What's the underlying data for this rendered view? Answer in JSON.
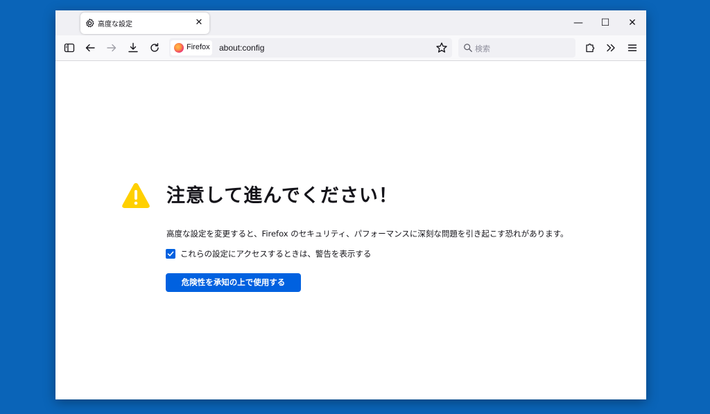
{
  "tab": {
    "title": "高度な設定",
    "icon": "gear-icon"
  },
  "window_controls": {
    "minimize": "—",
    "maximize": "☐",
    "close": "✕"
  },
  "urlbar": {
    "identity_label": "Firefox",
    "url": "about:config"
  },
  "search": {
    "placeholder": "検索"
  },
  "warning": {
    "heading": "注意して進んでください！",
    "description": "高度な設定を変更すると、Firefox のセキュリティ、パフォーマンスに深刻な問題を引き起こす恐れがあります。",
    "checkbox_label": "これらの設定にアクセスするときは、警告を表示する",
    "checkbox_checked": true,
    "accept_button": "危険性を承知の上で使用する"
  },
  "colors": {
    "desktop": "#0a64b8",
    "accent": "#0061e0",
    "warning_icon": "#ffd000"
  }
}
